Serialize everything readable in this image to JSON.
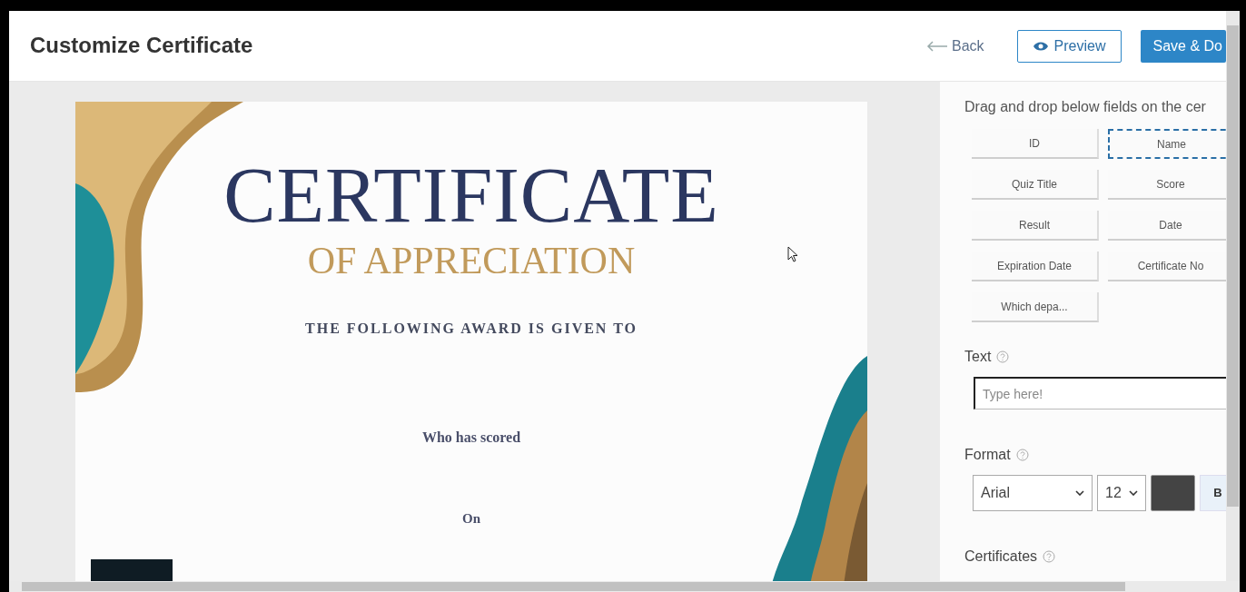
{
  "header": {
    "title": "Customize Certificate",
    "back": "Back",
    "preview": "Preview",
    "save": "Save & Do"
  },
  "certificate": {
    "title": "CERTIFICATE",
    "subtitle": "OF APPRECIATION",
    "given_to": "THE FOLLOWING AWARD IS GIVEN TO",
    "scored": "Who has scored",
    "on": "On"
  },
  "panel": {
    "instruction": "Drag and drop below fields on the cer",
    "fields": [
      {
        "label": "ID",
        "selected": false
      },
      {
        "label": "Name",
        "selected": true
      },
      {
        "label": "Quiz Title",
        "selected": false
      },
      {
        "label": "Score",
        "selected": false
      },
      {
        "label": "Result",
        "selected": false
      },
      {
        "label": "Date",
        "selected": false
      },
      {
        "label": "Expiration Date",
        "selected": false
      },
      {
        "label": "Certificate No",
        "selected": false
      },
      {
        "label": "Which depa...",
        "selected": false
      }
    ],
    "text_label": "Text",
    "text_placeholder": "Type here!",
    "format_label": "Format",
    "font": "Arial",
    "size": "12",
    "color": "#444444",
    "bold": "B",
    "certificates_label": "Certificates"
  }
}
